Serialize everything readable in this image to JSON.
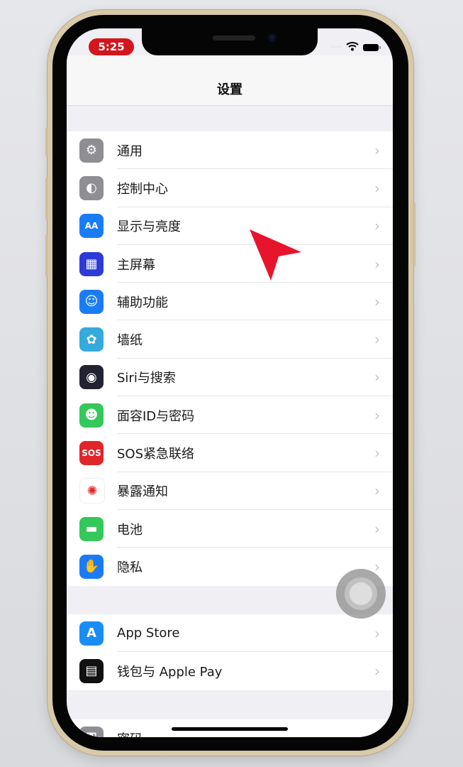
{
  "status_bar": {
    "time": "5:25",
    "time_badge_color": "#d3151d",
    "signal": "····",
    "wifi_icon": "wifi-icon",
    "battery_icon": "battery-icon"
  },
  "nav": {
    "title": "设置"
  },
  "groups": [
    {
      "items": [
        {
          "label": "通用",
          "icon": "gear-icon",
          "color": "#8e8e93",
          "glyph": "⚙"
        },
        {
          "label": "控制中心",
          "icon": "toggles-icon",
          "color": "#8e8e93",
          "glyph": "◐"
        },
        {
          "label": "显示与亮度",
          "icon": "text-size-icon",
          "color": "#1a7cf5",
          "glyph": "AA"
        },
        {
          "label": "主屏幕",
          "icon": "home-screen-icon",
          "color": "#2c3bd6",
          "glyph": "▦"
        },
        {
          "label": "辅助功能",
          "icon": "accessibility-icon",
          "color": "#1a7cf5",
          "glyph": "☺"
        },
        {
          "label": "墙纸",
          "icon": "wallpaper-flower-icon",
          "color": "#35aadc",
          "glyph": "✿"
        },
        {
          "label": "Siri与搜索",
          "icon": "siri-icon",
          "color": "#222233",
          "glyph": "◉"
        },
        {
          "label": "面容ID与密码",
          "icon": "face-id-icon",
          "color": "#34c759",
          "glyph": "☻"
        },
        {
          "label": "SOS紧急联络",
          "icon": "sos-icon",
          "color": "#e0262b",
          "glyph": "SOS"
        },
        {
          "label": "暴露通知",
          "icon": "exposure-icon",
          "color": "#ffffff",
          "glyph": "✺"
        },
        {
          "label": "电池",
          "icon": "battery-app-icon",
          "color": "#34c759",
          "glyph": "▬"
        },
        {
          "label": "隐私",
          "icon": "hand-icon",
          "color": "#1a7cf5",
          "glyph": "✋"
        }
      ]
    },
    {
      "items": [
        {
          "label": "App Store",
          "icon": "app-store-icon",
          "color": "#1a8df5",
          "glyph": "A"
        },
        {
          "label": "钱包与 Apple Pay",
          "icon": "wallet-icon",
          "color": "#111111",
          "glyph": "▤"
        }
      ]
    },
    {
      "items": [
        {
          "label": "密码",
          "icon": "key-icon",
          "color": "#8e8e93",
          "glyph": "⚿"
        }
      ]
    }
  ],
  "chevron": "›",
  "cursor_color": "#e8142c"
}
